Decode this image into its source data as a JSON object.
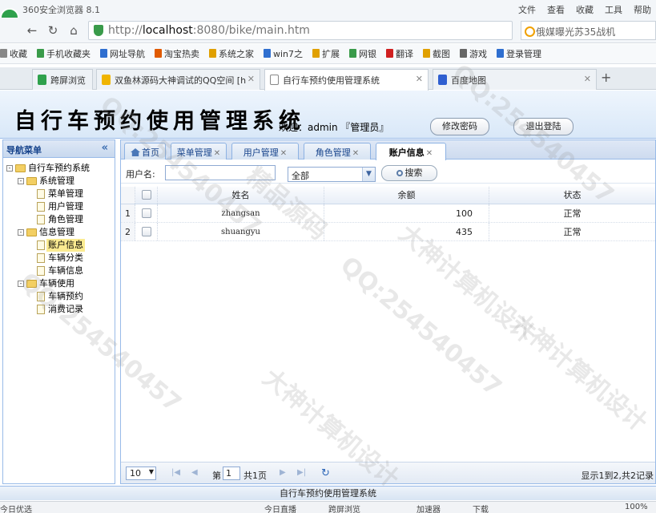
{
  "browser": {
    "title": "360安全浏览器 8.1",
    "menus": [
      "文件",
      "查看",
      "收藏",
      "工具",
      "帮助"
    ],
    "url_prefix": "http://",
    "url_host": "localhost",
    "url_rest": ":8080/bike/main.htm",
    "search_text": "俄媒曝光苏35战机",
    "favorites": [
      "收藏",
      "手机收藏夹",
      "网址导航",
      "淘宝热卖",
      "系统之家",
      "win7之",
      "扩展",
      "网银",
      "翻译",
      "截图",
      "游戏",
      "登录管理"
    ],
    "tabs": [
      {
        "label": "跨屏浏览",
        "color": "#2fa14c"
      },
      {
        "label": "双鱼林源码大神调试的QQ空间 [h",
        "color": "#f0b400"
      },
      {
        "label": "自行车预约使用管理系统",
        "color": "#8a8a8a"
      },
      {
        "label": "百度地图",
        "color": "#2f5fd0"
      }
    ]
  },
  "header": {
    "app_name": "自行车预约使用管理系统",
    "welcome": "欢迎：admin 『管理员』",
    "change_password": "修改密码",
    "logout": "退出登陆"
  },
  "sidebar": {
    "title": "导航菜单",
    "collapse": "«",
    "tree": [
      {
        "label": "自行车预约系统",
        "level": 0,
        "type": "folder",
        "exp": "-"
      },
      {
        "label": "系统管理",
        "level": 1,
        "type": "folder",
        "exp": "-"
      },
      {
        "label": "菜单管理",
        "level": 2,
        "type": "file"
      },
      {
        "label": "用户管理",
        "level": 2,
        "type": "file"
      },
      {
        "label": "角色管理",
        "level": 2,
        "type": "file"
      },
      {
        "label": "信息管理",
        "level": 1,
        "type": "folder",
        "exp": "-"
      },
      {
        "label": "账户信息",
        "level": 2,
        "type": "file",
        "selected": true
      },
      {
        "label": "车辆分类",
        "level": 2,
        "type": "file"
      },
      {
        "label": "车辆信息",
        "level": 2,
        "type": "file"
      },
      {
        "label": "车辆使用",
        "level": 1,
        "type": "folder",
        "exp": "-"
      },
      {
        "label": "车辆预约",
        "level": 2,
        "type": "file"
      },
      {
        "label": "消费记录",
        "level": 2,
        "type": "file"
      }
    ]
  },
  "tabs": [
    {
      "label": "首页",
      "closable": false
    },
    {
      "label": "菜单管理",
      "closable": true
    },
    {
      "label": "用户管理",
      "closable": true
    },
    {
      "label": "角色管理",
      "closable": true
    },
    {
      "label": "账户信息",
      "closable": true,
      "active": true
    }
  ],
  "toolbar": {
    "username_label": "用户名:",
    "username_value": "",
    "select_value": "全部",
    "search_label": "搜索"
  },
  "grid": {
    "columns": [
      "姓名",
      "余额",
      "状态"
    ],
    "rows": [
      {
        "num": "1",
        "name": "zhangsan",
        "balance": "100",
        "status": "正常"
      },
      {
        "num": "2",
        "name": "shuangyu",
        "balance": "435",
        "status": "正常"
      }
    ]
  },
  "pager": {
    "page_size": "10",
    "page_prefix": "第",
    "page_value": "1",
    "total_pages": "共1页",
    "info": "显示1到2,共2记录"
  },
  "footer": "自行车预约使用管理系统",
  "statusbar": [
    "今日优选",
    "今日直播",
    "跨屏浏览",
    "加速器",
    "下载",
    "100%"
  ],
  "watermarks": [
    "大神计算机设计",
    "QQ:254540457",
    "精品源码"
  ]
}
